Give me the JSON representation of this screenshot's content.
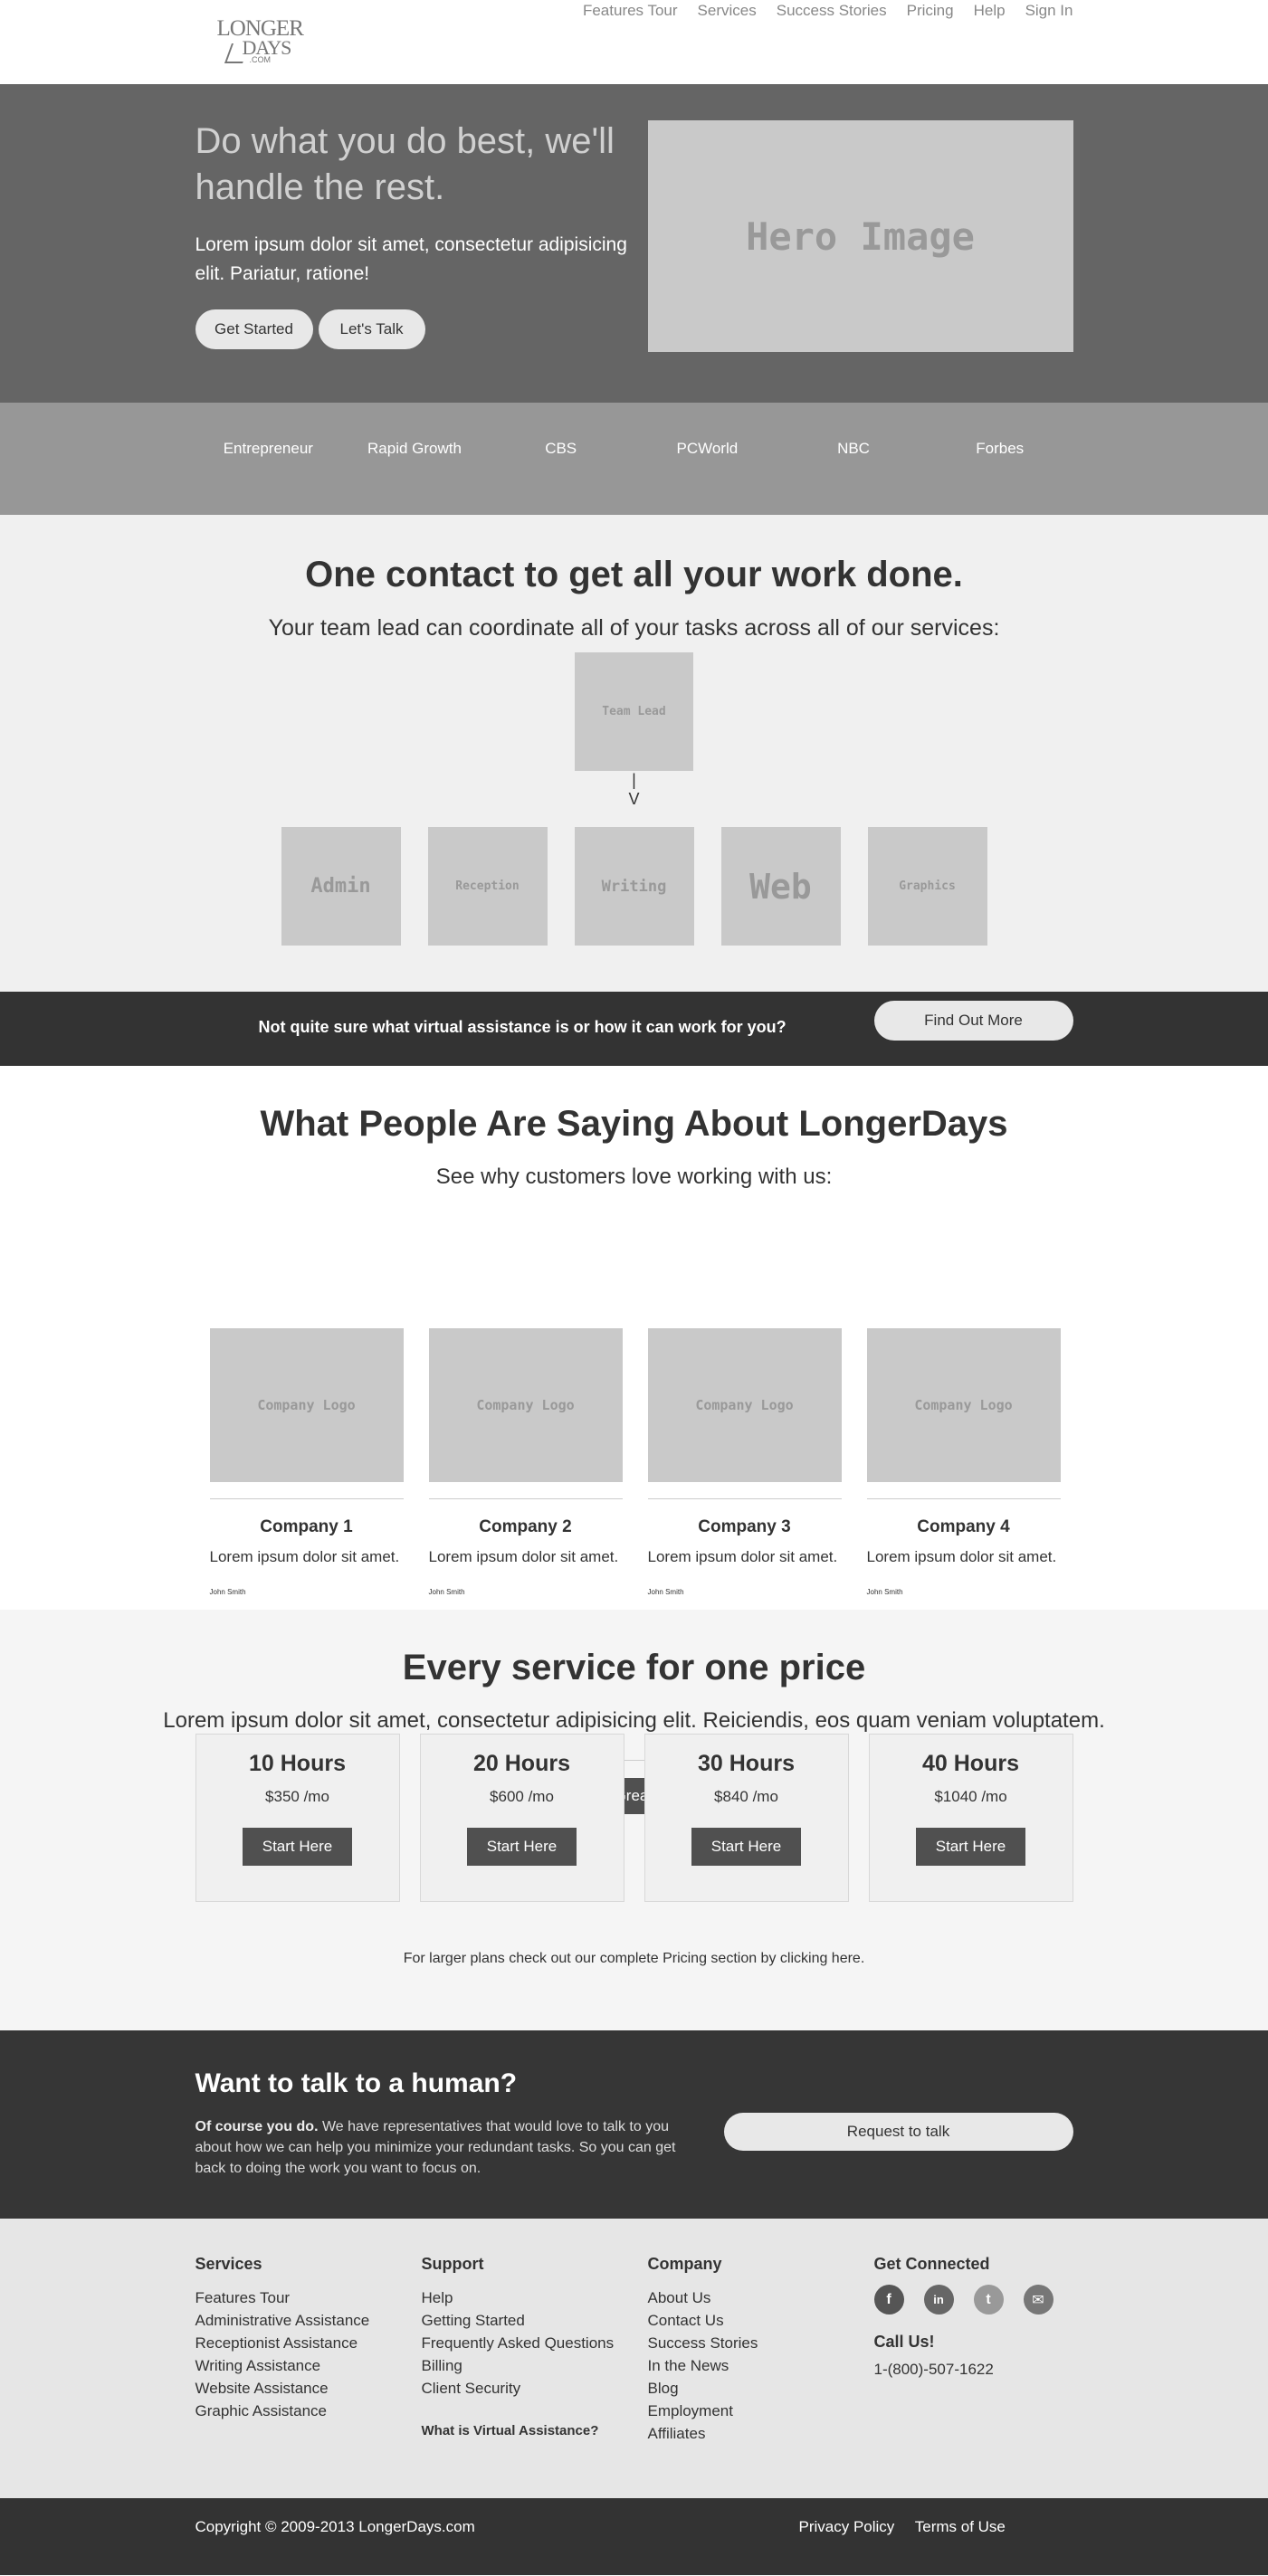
{
  "header": {
    "logo": {
      "line1": "LONGER",
      "line2": "DAYS",
      "line3": ".COM"
    },
    "nav": [
      "Features Tour",
      "Services",
      "Success Stories",
      "Pricing",
      "Help",
      "Sign In"
    ]
  },
  "hero": {
    "title": "Do what you do best, we'll handle the rest.",
    "text": "Lorem ipsum dolor sit amet, consectetur adipisicing elit. Pariatur, ratione!",
    "btn1": "Get Started",
    "btn2": "Let's Talk",
    "image": "Hero Image"
  },
  "press": [
    "Entrepreneur",
    "Rapid Growth",
    "CBS",
    "PCWorld",
    "NBC",
    "Forbes"
  ],
  "contact": {
    "title": "One contact to get all your work done.",
    "subtitle": "Your team lead can coordinate all of your tasks across all of our services:",
    "lead": "Team Lead",
    "arrow1": "|",
    "arrow2": "V",
    "services": [
      "Admin",
      "Reception",
      "Writing",
      "Web",
      "Graphics"
    ]
  },
  "band": {
    "question": "Not quite sure what virtual assistance is or how it can work for you?",
    "button": "Find Out More"
  },
  "testimonials": {
    "title": "What People Are Saying About LongerDays",
    "subtitle": "See why customers love working with us:",
    "logo": "Company Logo",
    "cards": [
      {
        "name": "Company 1",
        "text": "Lorem ipsum dolor sit amet.",
        "who": "John Smith"
      },
      {
        "name": "Company 2",
        "text": "Lorem ipsum dolor sit amet.",
        "who": "John Smith"
      },
      {
        "name": "Company 3",
        "text": "Lorem ipsum dolor sit amet.",
        "who": "John Smith"
      },
      {
        "name": "Company 4",
        "text": "Lorem ipsum dolor sit amet.",
        "who": "John Smith"
      }
    ],
    "join": "Join These Great Customers"
  },
  "pricing": {
    "title": "Every service for one price",
    "subtitle": "Lorem ipsum dolor sit amet, consectetur adipisicing elit. Reiciendis, eos quam veniam voluptatem.",
    "plans": [
      {
        "hours": "10 Hours",
        "price": "$350 /mo",
        "button": "Start Here"
      },
      {
        "hours": "20 Hours",
        "price": "$600 /mo",
        "button": "Start Here"
      },
      {
        "hours": "30 Hours",
        "price": "$840 /mo",
        "button": "Start Here"
      },
      {
        "hours": "40 Hours",
        "price": "$1040 /mo",
        "button": "Start Here"
      }
    ],
    "note": "For larger plans check out our complete Pricing section by clicking here."
  },
  "human": {
    "title": "Want to talk to a human?",
    "lead": "Of course you do.",
    "text": " We have representatives that would love to talk to you about how we can help you minimize your redundant tasks. So you can get back to doing the work you want to focus on.",
    "button": "Request to talk"
  },
  "footer": {
    "services": {
      "title": "Services",
      "links": [
        "Features Tour",
        "Administrative Assistance",
        "Receptionist Assistance",
        "Writing Assistance",
        "Website Assistance",
        "Graphic Assistance"
      ]
    },
    "support": {
      "title": "Support",
      "links": [
        "Help",
        "Getting Started",
        "Frequently Asked Questions",
        "Billing",
        "Client Security"
      ],
      "extra": "What is Virtual Assistance?"
    },
    "company": {
      "title": "Company",
      "links": [
        "About Us",
        "Contact Us",
        "Success Stories",
        "In the News",
        "Blog",
        "Employment",
        "Affiliates"
      ]
    },
    "connect": {
      "title": "Get Connected",
      "icons": [
        "f",
        "in",
        "t",
        "✉"
      ],
      "call_title": "Call Us!",
      "phone": "1-(800)-507-1622"
    },
    "social_colors": [
      "#555555",
      "#666666",
      "#999999",
      "#777777"
    ]
  },
  "bottom": {
    "copyright": "Copyright © 2009-2013 LongerDays.com",
    "privacy": "Privacy Policy",
    "terms": "Terms of Use"
  }
}
